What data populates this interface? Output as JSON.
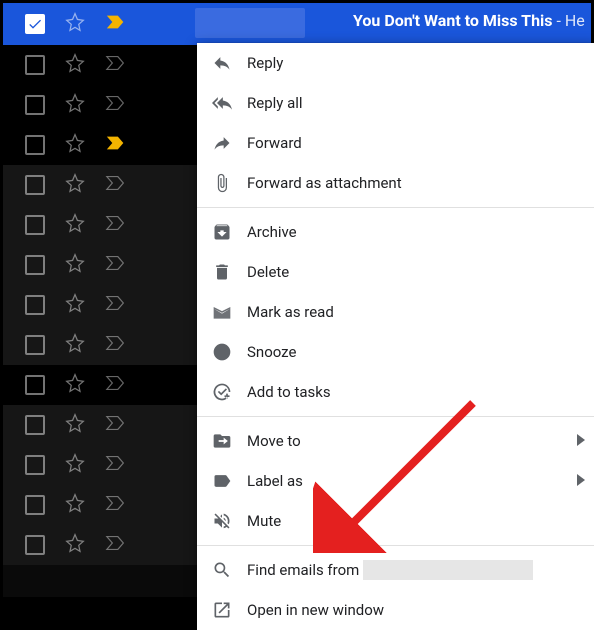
{
  "header": {
    "subject_bold": "You Don't Want to Miss This",
    "subject_tail": " - He"
  },
  "menu": {
    "reply": "Reply",
    "reply_all": "Reply all",
    "forward": "Forward",
    "forward_attachment": "Forward as attachment",
    "archive": "Archive",
    "delete": "Delete",
    "mark_read": "Mark as read",
    "snooze": "Snooze",
    "add_tasks": "Add to tasks",
    "move_to": "Move to",
    "label_as": "Label as",
    "mute": "Mute",
    "find_emails": "Find emails from",
    "open_window": "Open in new window"
  }
}
